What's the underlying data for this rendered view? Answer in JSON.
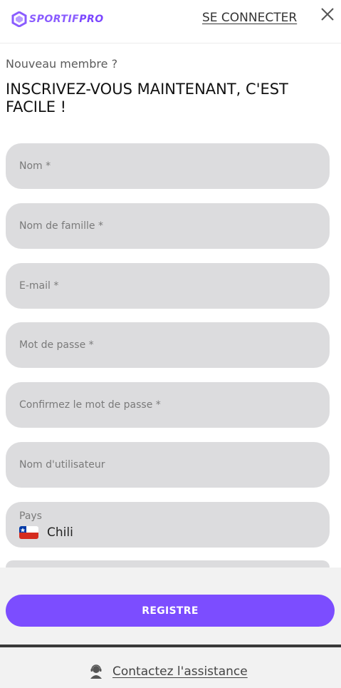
{
  "header": {
    "logo_text_a": "SPORTIF",
    "logo_text_b": "PRO",
    "signin_label": "SE CONNECTER",
    "close_icon": "close-icon"
  },
  "intro": {
    "subtitle": "Nouveau membre ?",
    "headline": "INSCRIVEZ-VOUS MAINTENANT, C'EST FACILE !"
  },
  "form": {
    "fields": [
      {
        "placeholder": "Nom *"
      },
      {
        "placeholder": "Nom de famille *"
      },
      {
        "placeholder": "E-mail *"
      },
      {
        "placeholder": "Mot de passe *"
      },
      {
        "placeholder": "Confirmez le mot de passe *"
      },
      {
        "placeholder": "Nom d'utilisateur"
      }
    ],
    "country": {
      "label": "Pays",
      "value": "Chili",
      "flag_icon": "chile-flag-icon"
    }
  },
  "actions": {
    "register_label": "REGISTRE"
  },
  "support": {
    "label": "Contactez l'assistance",
    "icon": "support-agent-icon"
  },
  "colors": {
    "accent": "#7c4dff",
    "field_bg": "#dcdcde"
  }
}
